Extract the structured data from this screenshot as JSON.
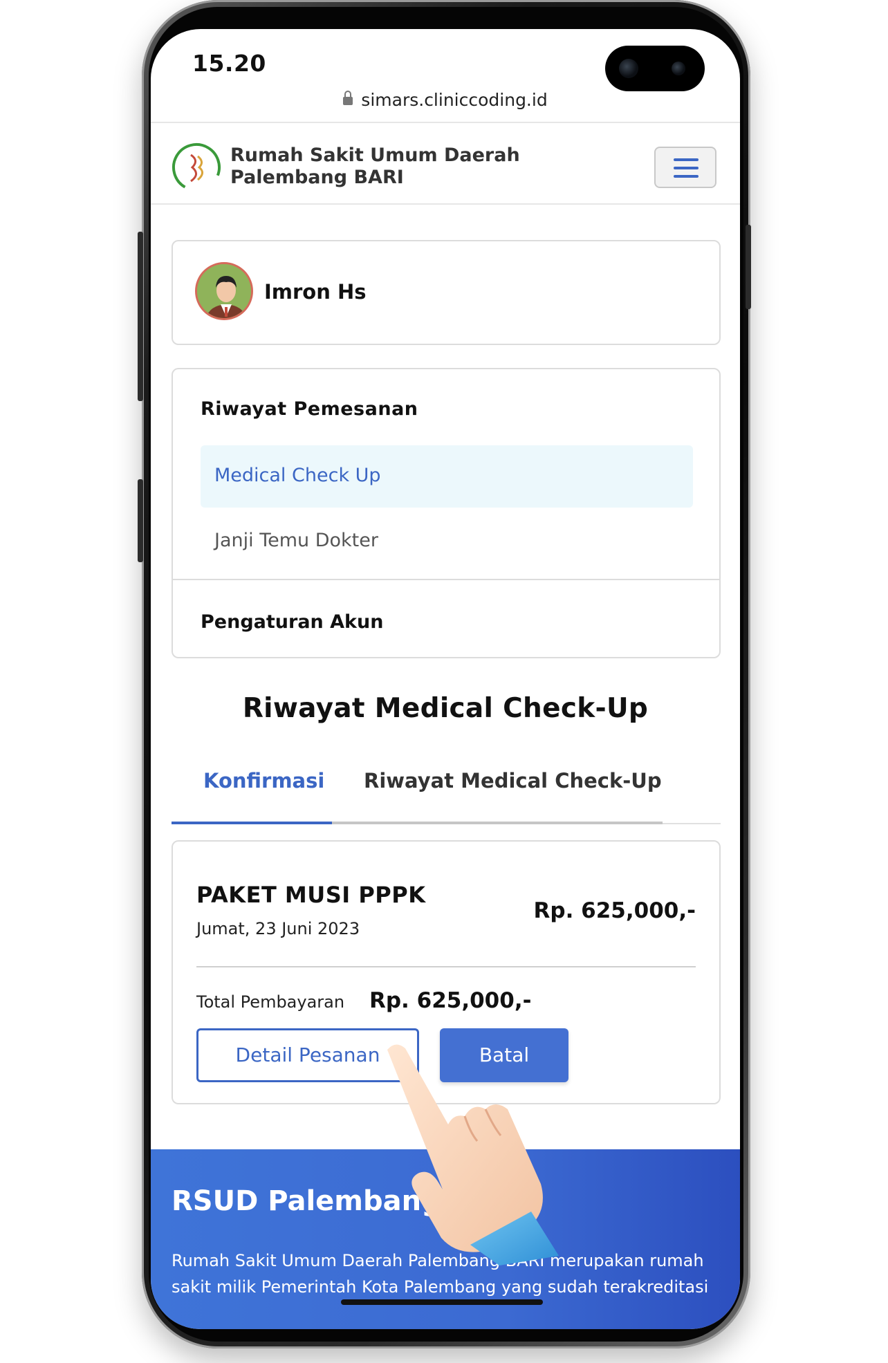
{
  "status_bar": {
    "time": "15.20"
  },
  "browser": {
    "url": "simars.cliniccoding.id"
  },
  "header": {
    "brand_line1": "Rumah Sakit Umum Daerah",
    "brand_line2": "Palembang BARI",
    "menu_icon": "hamburger-icon",
    "accent_color": "#3b66c4"
  },
  "profile": {
    "name": "Imron Hs"
  },
  "account_menu": {
    "section_title": "Riwayat Pemesanan",
    "items": [
      {
        "label": "Medical Check Up",
        "active": true
      },
      {
        "label": "Janji Temu Dokter",
        "active": false
      }
    ],
    "settings_label": "Pengaturan Akun"
  },
  "main": {
    "title": "Riwayat Medical Check-Up",
    "tabs": [
      {
        "label": "Konfirmasi",
        "active": true
      },
      {
        "label": "Riwayat Medical Check-Up",
        "active": false
      }
    ]
  },
  "order": {
    "package_name": "PAKET MUSI PPPK",
    "date": "Jumat, 23 Juni 2023",
    "price": "Rp. 625,000,-",
    "total_label": "Total Pembayaran",
    "total_value": "Rp. 625,000,-",
    "detail_button": "Detail Pesanan",
    "cancel_button": "Batal"
  },
  "footer": {
    "title": "RSUD Palembang BARI",
    "text": "Rumah Sakit Umum Daerah Palembang BARI merupakan rumah sakit milik Pemerintah Kota Palembang yang sudah terakreditasi"
  }
}
